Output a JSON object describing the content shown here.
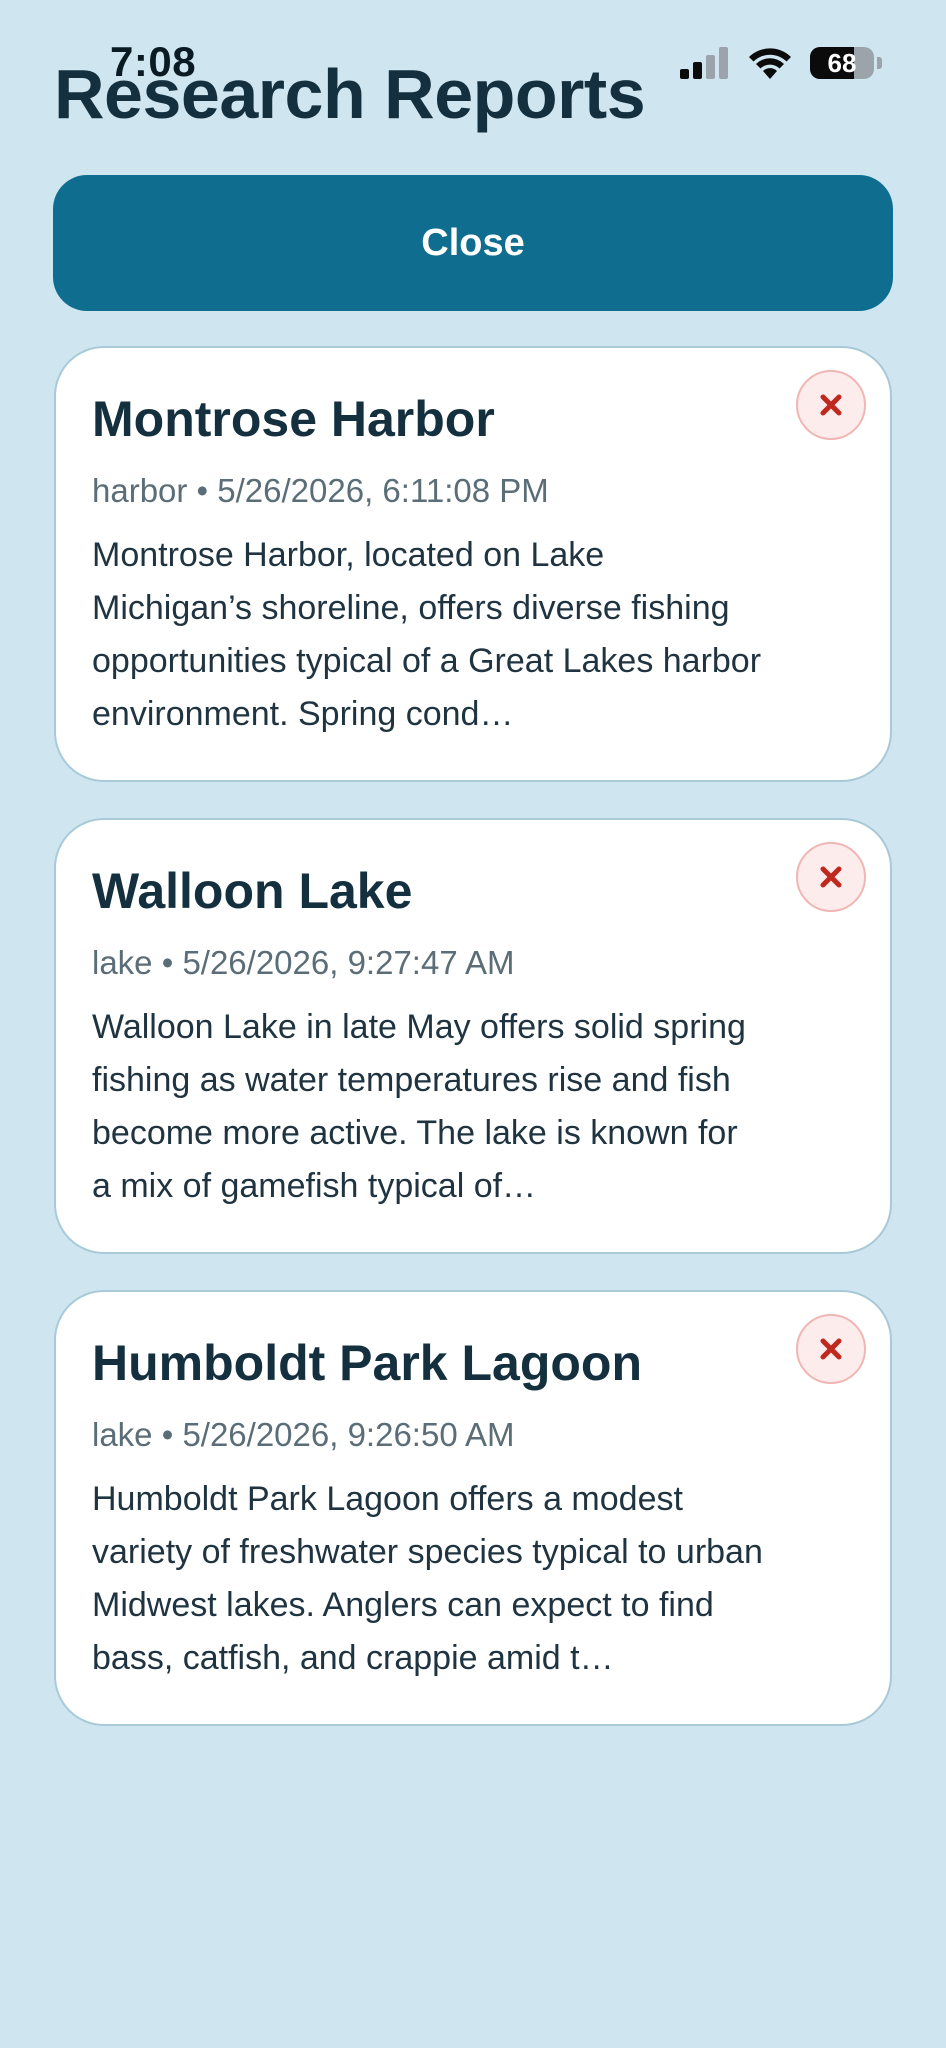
{
  "status_bar": {
    "time": "7:08",
    "battery_percent": "68",
    "battery_level": 0.68
  },
  "header": {
    "title": "Research Reports"
  },
  "actions": {
    "close_label": "Close"
  },
  "reports": [
    {
      "title": "Montrose Harbor",
      "type": "harbor",
      "timestamp": "5/26/2026, 6:11:08 PM",
      "summary": "Montrose Harbor, located on Lake Michigan’s shoreline, offers diverse fishing opportunities typical of a Great Lakes harbor environment. Spring cond…"
    },
    {
      "title": "Walloon Lake",
      "type": "lake",
      "timestamp": "5/26/2026, 9:27:47 AM",
      "summary": "Walloon Lake in late May offers solid spring fishing as water temperatures rise and fish become more active. The lake is known for a mix of gamefish typical of…"
    },
    {
      "title": "Humboldt Park Lagoon",
      "type": "lake",
      "timestamp": "5/26/2026, 9:26:50 AM",
      "summary": "Humboldt Park Lagoon offers a modest variety of freshwater species typical to urban Midwest lakes. Anglers can expect to find bass, catfish, and crappie amid t…"
    }
  ],
  "meta_separator": " • ",
  "icons": {
    "delete": "close-x-icon",
    "signal": "cellular-signal-icon",
    "wifi": "wifi-icon",
    "battery": "battery-icon"
  },
  "colors": {
    "background": "#cfe6f1",
    "primary_button": "#0f6e8f",
    "title_text": "#14303f",
    "delete_icon": "#c0281f",
    "delete_bg": "#fdecec"
  }
}
